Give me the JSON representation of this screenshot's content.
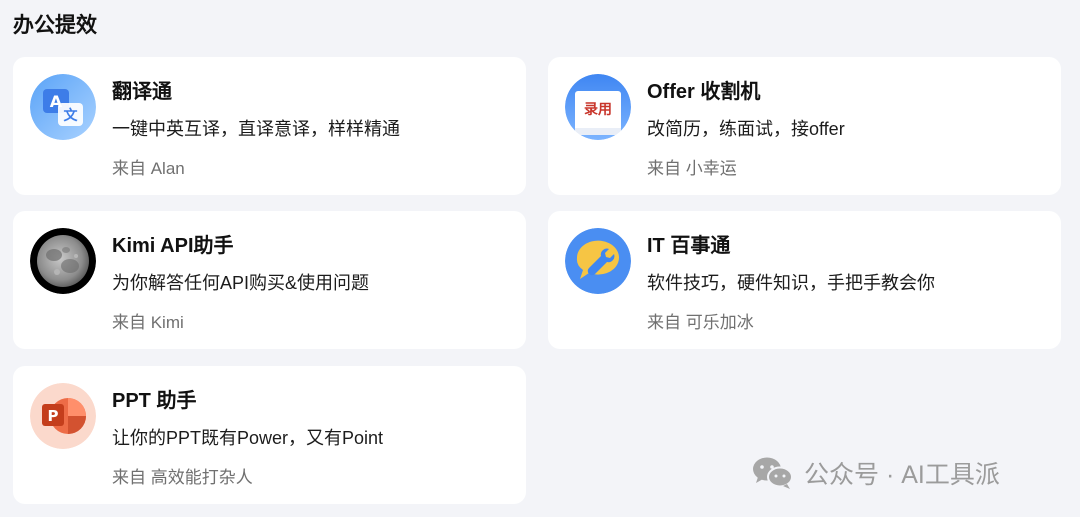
{
  "section": {
    "title": "办公提效"
  },
  "cards": [
    {
      "name": "翻译通",
      "desc": "一键中英互译，直译意译，样样精通",
      "author": "来自 Alan",
      "icon": "translate-icon"
    },
    {
      "name": "Offer 收割机",
      "desc": "改简历，练面试，接offer",
      "author": "来自 小幸运",
      "icon": "hired-stamp-icon",
      "icon_text": "录用"
    },
    {
      "name": "Kimi API助手",
      "desc": "为你解答任何API购买&使用问题",
      "author": "来自 Kimi",
      "icon": "moon-icon"
    },
    {
      "name": "IT 百事通",
      "desc": "软件技巧，硬件知识，手把手教会你",
      "author": "来自 可乐加冰",
      "icon": "wrench-chat-icon"
    },
    {
      "name": "PPT 助手",
      "desc": "让你的PPT既有Power，又有Point",
      "author": "来自 高效能打杂人",
      "icon": "powerpoint-icon"
    }
  ],
  "watermark": {
    "text": "公众号 · AI工具派",
    "icon": "wechat-icon"
  },
  "colors": {
    "background": "#f3f4f8",
    "card": "#ffffff",
    "muted_text": "#707070"
  }
}
